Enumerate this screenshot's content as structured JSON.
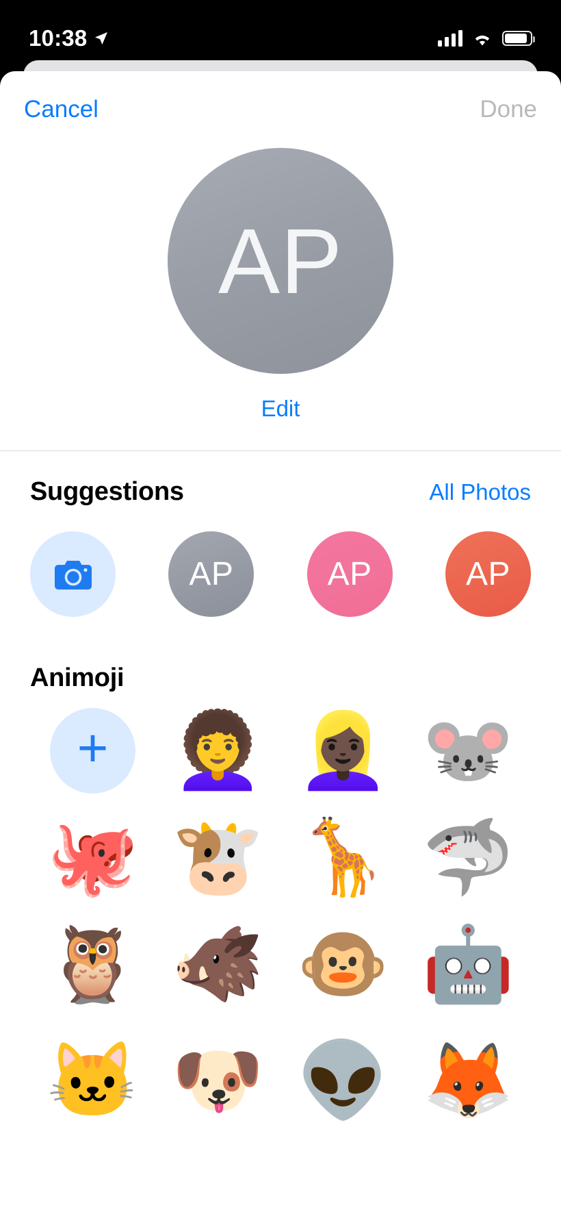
{
  "status_bar": {
    "time": "10:38",
    "icons": [
      "location-arrow-icon",
      "cellular-bars-icon",
      "wifi-icon",
      "battery-icon"
    ]
  },
  "nav": {
    "cancel_label": "Cancel",
    "done_label": "Done"
  },
  "avatar": {
    "initials": "AP",
    "edit_label": "Edit",
    "color": "#9a9ea7"
  },
  "suggestions": {
    "title": "Suggestions",
    "action_label": "All Photos",
    "items": [
      {
        "type": "camera",
        "icon": "camera-icon",
        "label": "",
        "color": "#daeaff"
      },
      {
        "type": "monogram",
        "icon": "",
        "label": "AP",
        "color": "#8b8f99"
      },
      {
        "type": "monogram",
        "icon": "",
        "label": "AP",
        "color": "#ef6e96"
      },
      {
        "type": "monogram",
        "icon": "",
        "label": "AP",
        "color": "#e85b47"
      }
    ]
  },
  "animoji": {
    "title": "Animoji",
    "add_label": "+",
    "items": [
      {
        "name": "add-animoji",
        "glyph": ""
      },
      {
        "name": "memoji-bun-glasses",
        "glyph": "👩‍🦱"
      },
      {
        "name": "memoji-bucket-hat-blonde",
        "glyph": "👱🏿‍♀️"
      },
      {
        "name": "mouse",
        "glyph": "🐭"
      },
      {
        "name": "octopus",
        "glyph": "🐙"
      },
      {
        "name": "cow",
        "glyph": "🐮"
      },
      {
        "name": "giraffe",
        "glyph": "🦒"
      },
      {
        "name": "shark",
        "glyph": "🦈"
      },
      {
        "name": "owl",
        "glyph": "🦉"
      },
      {
        "name": "boar",
        "glyph": "🐗"
      },
      {
        "name": "monkey",
        "glyph": "🐵"
      },
      {
        "name": "robot",
        "glyph": "🤖"
      },
      {
        "name": "cat",
        "glyph": "🐱"
      },
      {
        "name": "dog",
        "glyph": "🐶"
      },
      {
        "name": "alien",
        "glyph": "👽"
      },
      {
        "name": "fox",
        "glyph": "🦊"
      }
    ]
  },
  "colors": {
    "accent_blue": "#0a7cff",
    "disabled_gray": "#b9b9bd",
    "sheet_white": "#ffffff",
    "light_blue_fill": "#daeaff"
  }
}
